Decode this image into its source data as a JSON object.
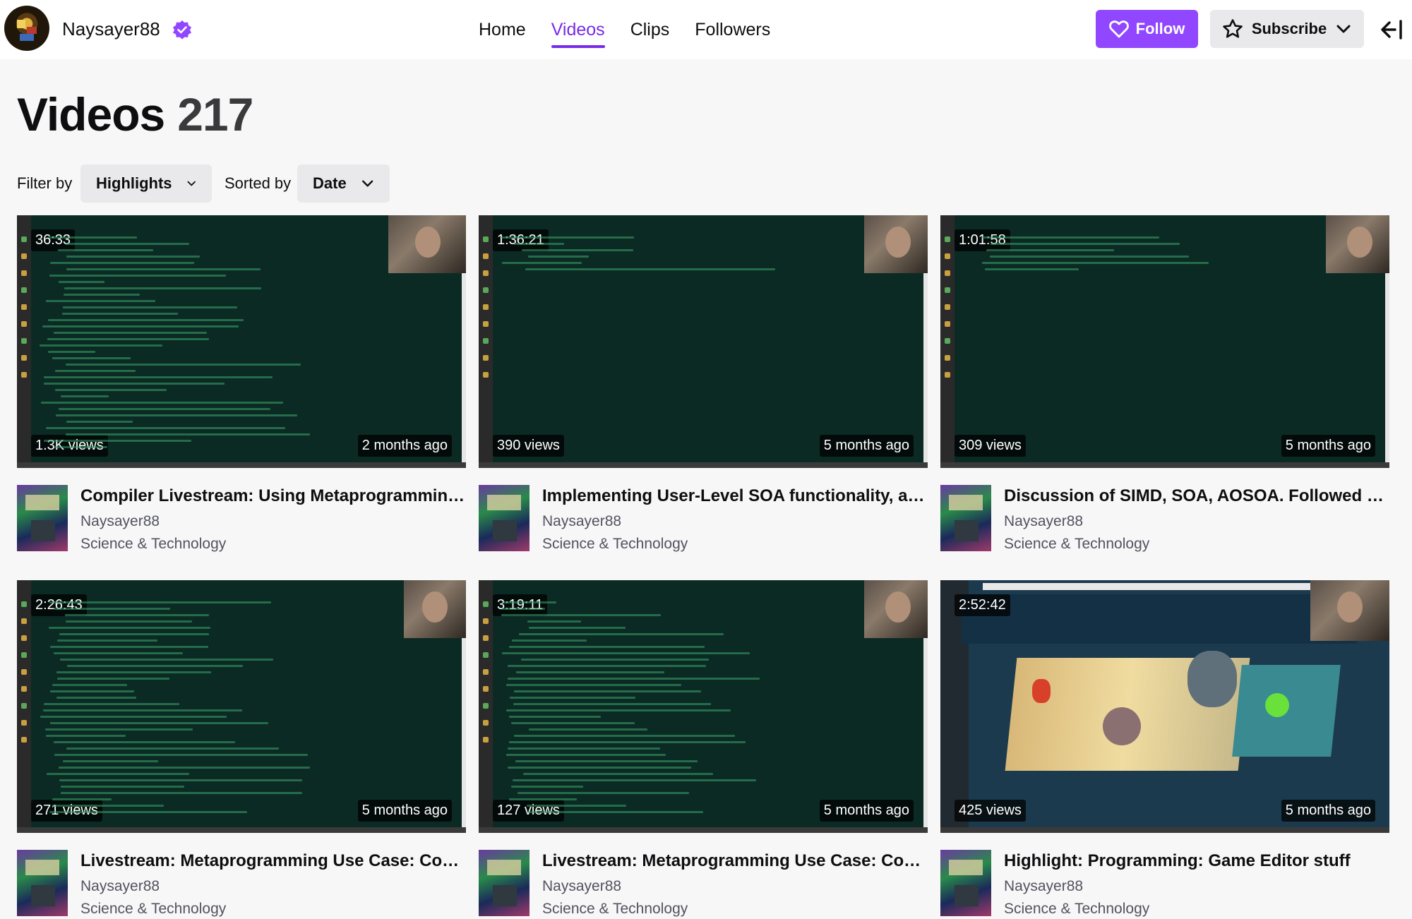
{
  "header": {
    "channel_name": "Naysayer88",
    "nav_tabs": [
      {
        "label": "Home",
        "active": false
      },
      {
        "label": "Videos",
        "active": true
      },
      {
        "label": "Clips",
        "active": false
      },
      {
        "label": "Followers",
        "active": false
      }
    ],
    "follow_label": "Follow",
    "subscribe_label": "Subscribe",
    "accent_color": "#9147ff"
  },
  "page": {
    "title": "Videos",
    "count": "217"
  },
  "filters": {
    "filter_label": "Filter by",
    "filter_value": "Highlights",
    "sort_label": "Sorted by",
    "sort_value": "Date"
  },
  "videos": [
    {
      "duration": "36:33",
      "views": "1.3K views",
      "age": "2 months ago",
      "title": "Compiler Livestream: Using Metaprogramming and Stuff",
      "channel": "Naysayer88",
      "category": "Science & Technology"
    },
    {
      "duration": "1:36:21",
      "views": "390 views",
      "age": "5 months ago",
      "title": "Implementing User-Level SOA functionality, and More",
      "channel": "Naysayer88",
      "category": "Science & Technology"
    },
    {
      "duration": "1:01:58",
      "views": "309 views",
      "age": "5 months ago",
      "title": "Discussion of SIMD, SOA, AOSOA. Followed by More",
      "channel": "Naysayer88",
      "category": "Science & Technology"
    },
    {
      "duration": "2:26:43",
      "views": "271 views",
      "age": "5 months ago",
      "title": "Livestream: Metaprogramming Use Case: Command Line",
      "channel": "Naysayer88",
      "category": "Science & Technology"
    },
    {
      "duration": "3:19:11",
      "views": "127 views",
      "age": "5 months ago",
      "title": "Livestream: Metaprogramming Use Case: Command Line Parsing",
      "channel": "Naysayer88",
      "category": "Science & Technology"
    },
    {
      "duration": "2:52:42",
      "views": "425 views",
      "age": "5 months ago",
      "title": "Highlight: Programming: Game Editor stuff",
      "channel": "Naysayer88",
      "category": "Science & Technology"
    }
  ]
}
